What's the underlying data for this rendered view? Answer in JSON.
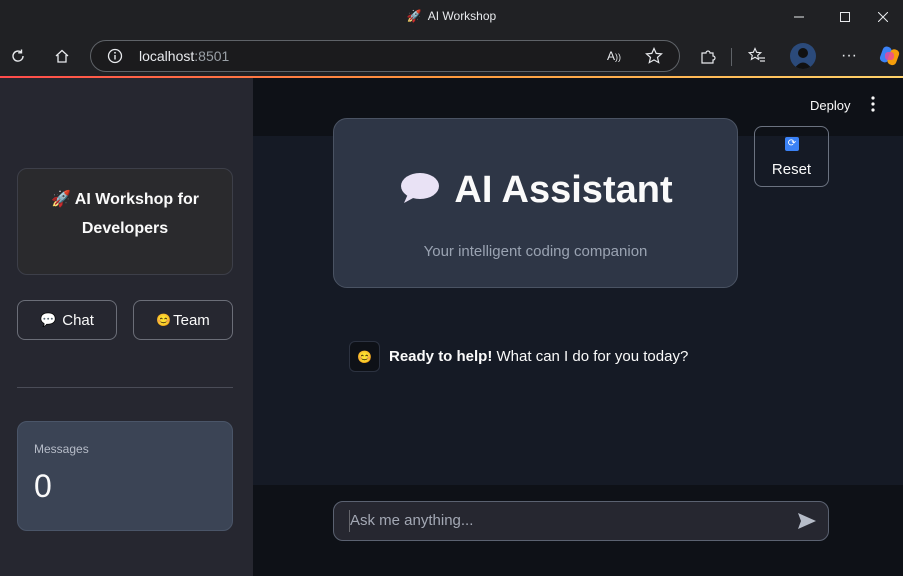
{
  "window": {
    "title": "AI Workshop",
    "title_icon": "rocket",
    "controls": [
      "minimize",
      "maximize",
      "close"
    ]
  },
  "browser": {
    "url_host": "localhost",
    "url_port": ":8501",
    "toolbar_icons": [
      "refresh-icon",
      "home-icon",
      "info-icon",
      "read-aloud-icon",
      "favorite-star-icon",
      "extensions-icon",
      "favorites-list-icon",
      "profile-avatar",
      "more-icon",
      "copilot-icon"
    ]
  },
  "sidebar": {
    "brand_line1": "🚀 AI Workshop for",
    "brand_line2": "Developers",
    "nav": [
      {
        "icon": "💬",
        "label": "Chat"
      },
      {
        "icon": "😊",
        "label": "Team"
      }
    ],
    "metric": {
      "label": "Messages",
      "value": "0"
    }
  },
  "header": {
    "deploy_label": "Deploy"
  },
  "hero": {
    "icon": "💬",
    "title": "AI Assistant",
    "subtitle": "Your intelligent coding companion"
  },
  "reset": {
    "icon": "🔄",
    "label": "Reset"
  },
  "chat": {
    "avatar_icon": "😊",
    "bold": "Ready to help!",
    "text": " What can I do for you today?"
  },
  "input": {
    "placeholder": "Ask me anything...",
    "value": ""
  },
  "colors": {
    "accent_gradient": [
      "#ff4b4b",
      "#ffd36b"
    ],
    "sidebar_bg": "#262730",
    "main_bg": "#151a25"
  }
}
